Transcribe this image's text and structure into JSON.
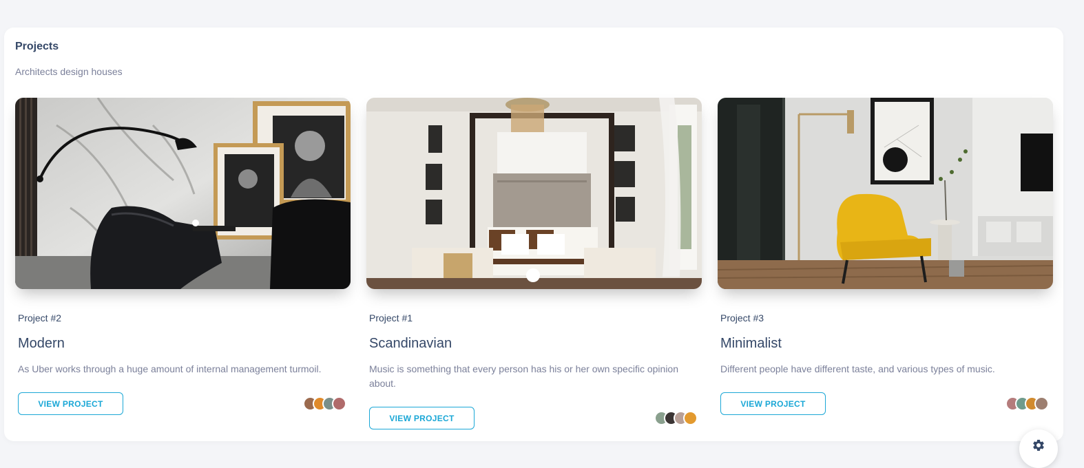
{
  "section": {
    "title": "Projects",
    "subtitle": "Architects design houses"
  },
  "projects": [
    {
      "label": "Project #2",
      "title": "Modern",
      "description": "As Uber works through a huge amount of internal management turmoil.",
      "button": "VIEW PROJECT",
      "image": "modern-living-room-photo"
    },
    {
      "label": "Project #1",
      "title": "Scandinavian",
      "description": "Music is something that every person has his or her own specific opinion about.",
      "button": "VIEW PROJECT",
      "image": "scandinavian-bedroom-photo"
    },
    {
      "label": "Project #3",
      "title": "Minimalist",
      "description": "Different people have different taste, and various types of music.",
      "button": "VIEW PROJECT",
      "image": "minimalist-yellow-chair-photo"
    }
  ],
  "colors": {
    "accent": "#1aa7d6",
    "heading": "#344767",
    "muted": "#7b809a"
  },
  "fab_icon": "gear-icon"
}
